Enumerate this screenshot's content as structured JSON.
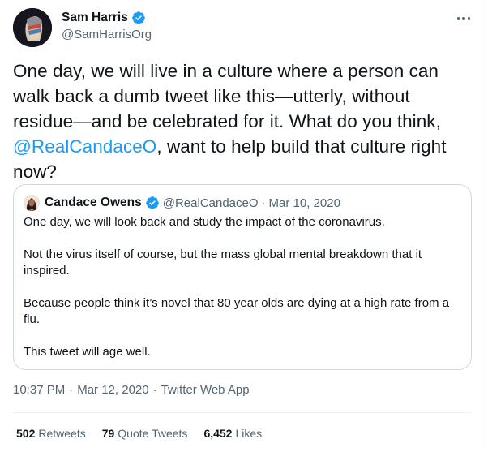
{
  "author": {
    "display_name": "Sam Harris",
    "handle": "@SamHarrisOrg"
  },
  "tweet": {
    "text_before_mention": "One day, we will live in a culture where a person can walk back a dumb tweet like this—utterly, without residue—and be celebrated for it. What do you think, ",
    "mention": "@RealCandaceO",
    "text_after_mention": ", want to help build that culture right now?"
  },
  "quoted": {
    "display_name": "Candace Owens",
    "handle": "@RealCandaceO",
    "separator": "·",
    "date": "Mar 10, 2020",
    "paragraphs": [
      "One day, we will look back and study the impact of the coronavirus.",
      "Not the virus itself of course, but the mass global mental breakdown that it inspired.",
      "Because people think it’s novel that 80 year olds are dying at a high rate from a flu.",
      "This tweet will age well."
    ]
  },
  "meta": {
    "time": "10:37 PM",
    "separator": "·",
    "date": "Mar 12, 2020",
    "source": "Twitter Web App"
  },
  "stats": {
    "retweets_count": "502",
    "retweets_label": "Retweets",
    "quotes_count": "79",
    "quotes_label": "Quote Tweets",
    "likes_count": "6,452",
    "likes_label": "Likes"
  },
  "colors": {
    "accent": "#1d9bf0",
    "text_primary": "#0f1419",
    "text_secondary": "#536471",
    "border": "#cfd9de"
  },
  "icons": {
    "verified": "verified-badge-icon",
    "more": "more-options-icon"
  }
}
